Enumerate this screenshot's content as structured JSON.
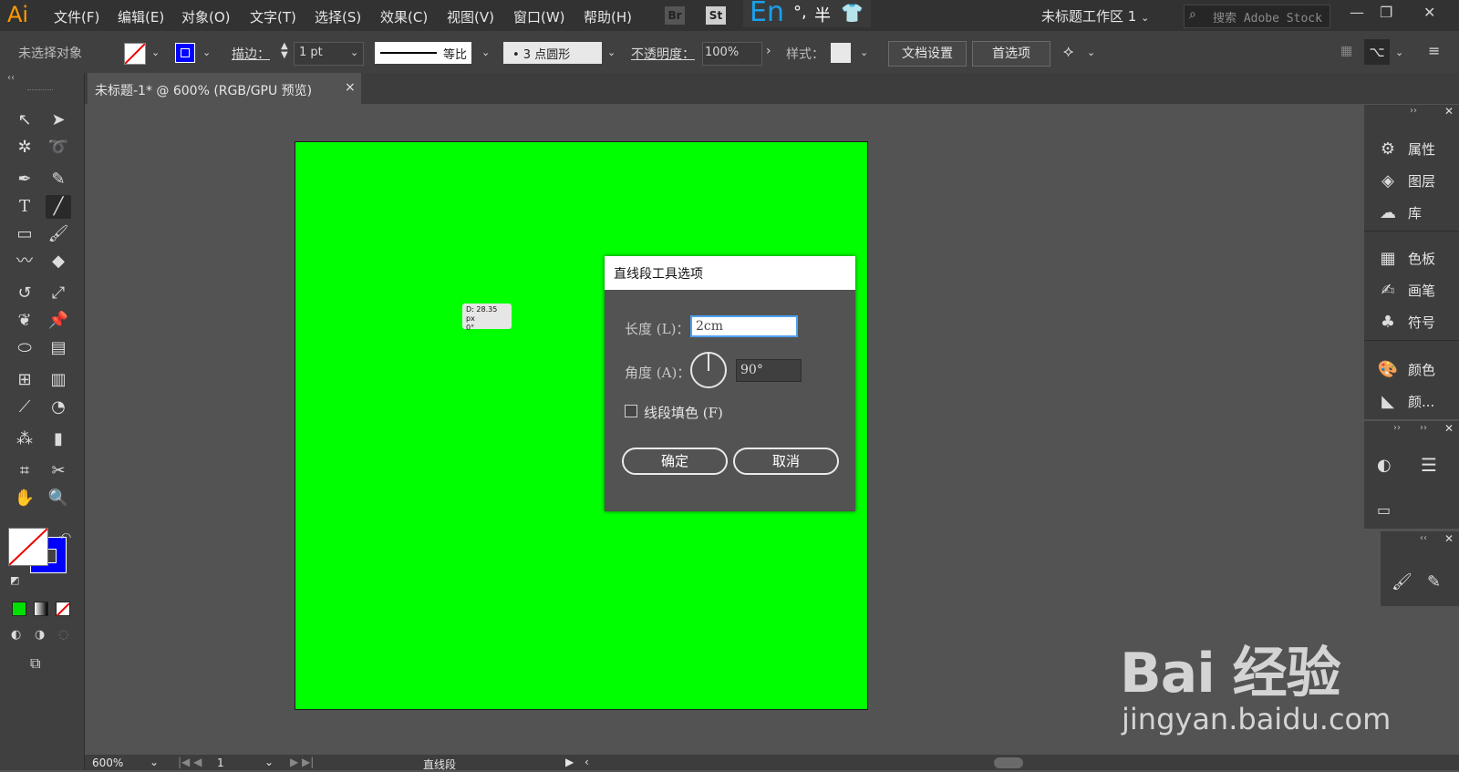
{
  "app": {
    "logo": "Ai",
    "menu": [
      "文件(F)",
      "编辑(E)",
      "对象(O)",
      "文字(T)",
      "选择(S)",
      "效果(C)",
      "视图(V)",
      "窗口(W)",
      "帮助(H)"
    ],
    "bridge_label": "Br",
    "stock_label": "St",
    "ime": {
      "lang": "En",
      "punct": "°,",
      "width": "半",
      "skin": "👕"
    },
    "workspace": "未标题工作区 1",
    "search_placeholder": "搜索 Adobe Stock",
    "window_controls": [
      "—",
      "❐",
      "✕"
    ]
  },
  "control_bar": {
    "selection_status": "未选择对象",
    "stroke_label": "描边：",
    "stroke_weight": "1 pt",
    "stroke_profile": "等比",
    "brush": "• 3 点圆形",
    "opacity_label": "不透明度：",
    "opacity_value": "100%",
    "style_label": "样式：",
    "doc_setup_button": "文档设置",
    "preferences_button": "首选项"
  },
  "document": {
    "tab_title": "未标题-1* @ 600% (RGB/GPU 预览)",
    "tab_close": "×",
    "tooltip_line1": "D: 28.35 px",
    "tooltip_line2": "0°",
    "artboard_color": "#00ff00"
  },
  "dialog": {
    "title": "直线段工具选项",
    "length_label": "长度 (L)：",
    "length_value": "2cm",
    "angle_label": "角度 (A)：",
    "angle_value": "90°",
    "fill_label": "线段填色 (F)",
    "fill_checked": false,
    "ok_button": "确定",
    "cancel_button": "取消"
  },
  "right_panels": {
    "group1": [
      {
        "icon": "properties-icon",
        "label": "属性"
      },
      {
        "icon": "layers-icon",
        "label": "图层"
      },
      {
        "icon": "libraries-icon",
        "label": "库"
      }
    ],
    "group2": [
      {
        "icon": "swatches-icon",
        "label": "色板"
      },
      {
        "icon": "brushes-icon",
        "label": "画笔"
      },
      {
        "icon": "symbols-icon",
        "label": "符号"
      }
    ],
    "group3": [
      {
        "icon": "color-icon",
        "label": "颜色"
      },
      {
        "icon": "color-guide-icon",
        "label": "颜..."
      }
    ]
  },
  "status_bar": {
    "zoom": "600%",
    "artboard_index": "1",
    "current_tool": "直线段"
  },
  "colors": {
    "fill_swatch": "#ffffff",
    "stroke_swatch": "#0000ff",
    "accent": "#4da0f0"
  },
  "watermark": {
    "brand": "Bai 经验",
    "url": "jingyan.baidu.com"
  }
}
